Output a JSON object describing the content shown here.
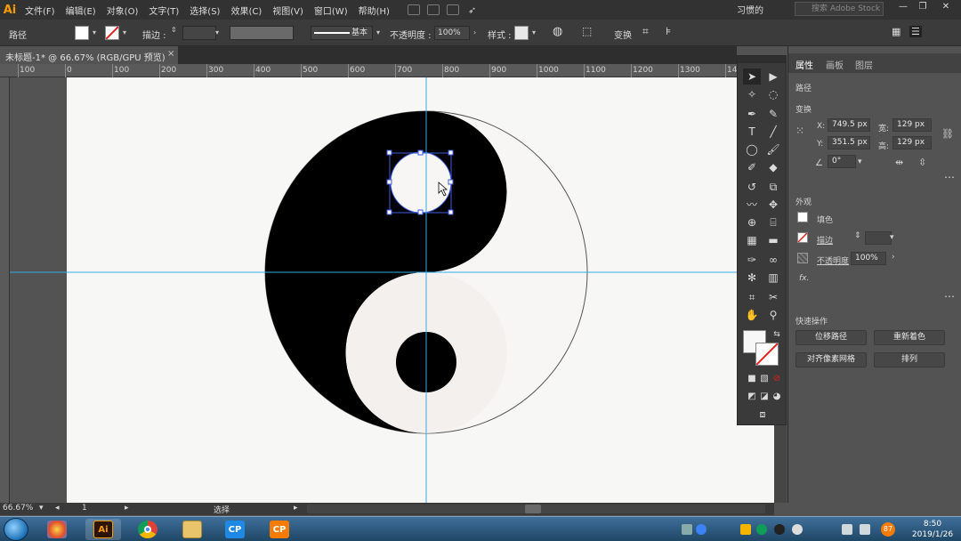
{
  "app": {
    "logo": "Ai",
    "menus": [
      "文件(F)",
      "编辑(E)",
      "对象(O)",
      "文字(T)",
      "选择(S)",
      "效果(C)",
      "视图(V)",
      "窗口(W)",
      "帮助(H)"
    ],
    "workspace": "习惯的",
    "search_placeholder": "搜索 Adobe Stock"
  },
  "controlbar": {
    "selection_type": "路径",
    "stroke_label": "描边 :",
    "stroke_profile": "基本",
    "opacity_label": "不透明度 :",
    "opacity_value": "100%",
    "style_label": "样式 :",
    "transform_label": "变换"
  },
  "document": {
    "tab_title": "未标题-1* @ 66.67% (RGB/GPU 预览)",
    "tab_close": "×"
  },
  "ruler": {
    "labels": [
      "100",
      "0",
      "100",
      "200",
      "300",
      "400",
      "500",
      "600",
      "700",
      "800",
      "900",
      "1000",
      "1100",
      "1200",
      "1300",
      "14"
    ]
  },
  "panel": {
    "tabs": [
      "属性",
      "画板",
      "图层"
    ],
    "section_path": "路径",
    "section_transform": "变换",
    "x_label": "X:",
    "x_value": "749.5 px",
    "y_label": "Y:",
    "y_value": "351.5 px",
    "w_label": "宽:",
    "w_value": "129 px",
    "h_label": "高:",
    "h_value": "129 px",
    "angle_value": "0°",
    "section_appearance": "外观",
    "fill_label": "填色",
    "stroke_label": "描边",
    "opacity_label": "不透明度",
    "opacity_value": "100%",
    "fx_label": "fx.",
    "section_quick": "快速操作",
    "btn_offset_path": "位移路径",
    "btn_recolor": "重新着色",
    "btn_align_pixel": "对齐像素网格",
    "btn_arrange": "排列"
  },
  "status": {
    "zoom": "66.67%",
    "artboard_num": "1",
    "tool": "选择"
  },
  "taskbar": {
    "time": "8:50",
    "date": "2019/1/26",
    "apps": [
      "Ai",
      "Chrome",
      "Folder",
      "CP",
      "CP"
    ]
  },
  "colors": {
    "accent": "#ff9a00",
    "guide": "#3aa8e8",
    "selection": "#3b5bdb",
    "black": "#000000",
    "white": "#f7f6f4"
  }
}
